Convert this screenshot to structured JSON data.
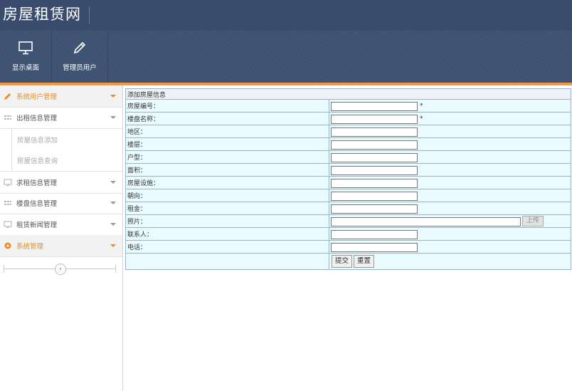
{
  "header": {
    "title": "房屋租赁网"
  },
  "toolbar": {
    "buttons": [
      {
        "label": "显示桌面",
        "icon": "monitor-icon"
      },
      {
        "label": "管理员用户",
        "icon": "pencil-icon"
      }
    ]
  },
  "colors": {
    "header": "#394c6e",
    "toolbar": "#3d5172",
    "accent": "#f59842",
    "form_bg": "#eafbff"
  },
  "sidebar": {
    "menus": [
      {
        "label": "系统用户管理",
        "icon": "pencil-icon",
        "active": true
      },
      {
        "label": "出租信息管理",
        "icon": "grid-icon",
        "active": false
      },
      {
        "label": "求租信息管理",
        "icon": "monitor-icon",
        "active": false
      },
      {
        "label": "楼盘信息管理",
        "icon": "grid-icon",
        "active": false
      },
      {
        "label": "租赁新闻管理",
        "icon": "monitor-icon",
        "active": false
      },
      {
        "label": "系统管理",
        "icon": "settings-icon",
        "active": true
      }
    ],
    "submenu": [
      {
        "label": "房屋信息添加"
      },
      {
        "label": "房屋信息查询"
      }
    ],
    "collapse_icon": "chevron-left-icon"
  },
  "form": {
    "caption": "添加房屋信息",
    "fields": [
      {
        "label": "房屋编号：",
        "value": "",
        "required": "*"
      },
      {
        "label": "楼盘名称：",
        "value": "",
        "required": "*"
      },
      {
        "label": "地区：",
        "value": ""
      },
      {
        "label": "楼层：",
        "value": ""
      },
      {
        "label": "户型：",
        "value": ""
      },
      {
        "label": "面积：",
        "value": ""
      },
      {
        "label": "房屋设施：",
        "value": ""
      },
      {
        "label": "朝向：",
        "value": ""
      },
      {
        "label": "租金：",
        "value": ""
      },
      {
        "label": "照片：",
        "value": "",
        "upload": "上传"
      },
      {
        "label": "联系人：",
        "value": ""
      },
      {
        "label": "电话：",
        "value": ""
      }
    ],
    "submit_label": "提交",
    "reset_label": "重置"
  }
}
